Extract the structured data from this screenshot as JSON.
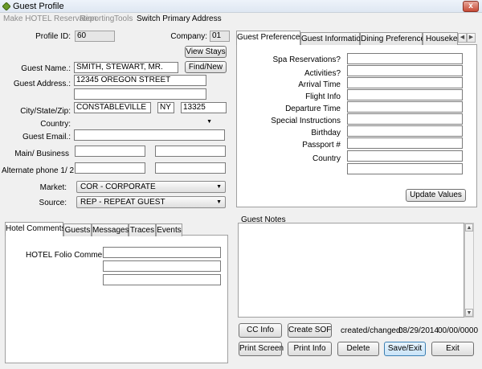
{
  "window": {
    "title": "Guest Profile",
    "close_glyph": "x"
  },
  "menu": [
    "Make HOTEL Reservation",
    "Reporting",
    "Tools",
    "Switch Primary Address"
  ],
  "profile": {
    "profile_id_label": "Profile ID:",
    "profile_id": "60",
    "company_label": "Company:",
    "company": "01",
    "view_stays": "View Stays",
    "guest_name_label": "Guest Name.:",
    "guest_name": "SMITH, STEWART, MR.",
    "find_new": "Find/New",
    "guest_address_label": "Guest Address.:",
    "address1": "12345 OREGON STREET",
    "address2": "",
    "city_label": "City/State/Zip:",
    "city": "CONSTABLEVILLE",
    "state": "NY",
    "zip": "13325",
    "country_label": "Country:",
    "country": "",
    "email_label": "Guest Email.:",
    "email": "",
    "main_label": "Main/ Business",
    "main_phone": "",
    "business_phone": "",
    "alt_label": "Alternate phone 1/ 2:",
    "alt1": "",
    "alt2": "",
    "market_label": "Market:",
    "market": "COR  - CORPORATE",
    "source_label": "Source:",
    "source": "REP  - REPEAT GUEST"
  },
  "comments": {
    "tabs": [
      "Hotel Comments",
      "Guests",
      "Messages",
      "Traces",
      "Events"
    ],
    "folio_label": "HOTEL Folio Comment:",
    "lines": [
      "",
      "",
      ""
    ]
  },
  "preferences": {
    "tabs": [
      "Guest Preferences",
      "Guest Information",
      "Dining Preferences",
      "Housekee"
    ],
    "fields": [
      {
        "label": "Spa Reservations?",
        "value": ""
      },
      {
        "label": "Activities?",
        "value": ""
      },
      {
        "label": "Arrival Time",
        "value": ""
      },
      {
        "label": "Flight Info",
        "value": ""
      },
      {
        "label": "Departure Time",
        "value": ""
      },
      {
        "label": "Special Instructions",
        "value": ""
      },
      {
        "label": "Birthday",
        "value": ""
      },
      {
        "label": "Passport #",
        "value": ""
      },
      {
        "label": "Country",
        "value": ""
      },
      {
        "label": "",
        "value": ""
      }
    ],
    "update_button": "Update Values"
  },
  "notes": {
    "label": "Guest Notes",
    "text": ""
  },
  "footer": {
    "cc_info": "CC Info",
    "create_sof": "Create SOF",
    "created_label": "created/changed:",
    "created": "08/29/2014",
    "changed": "00/00/0000",
    "print_screen": "Print Screen",
    "print_info": "Print Info",
    "delete": "Delete",
    "save_exit": "Save/Exit",
    "exit": "Exit"
  },
  "colors": {
    "window_bg": "#f0f0f0",
    "field_border": "#7a7a7a",
    "disabled_menu": "#8c8c8c"
  }
}
